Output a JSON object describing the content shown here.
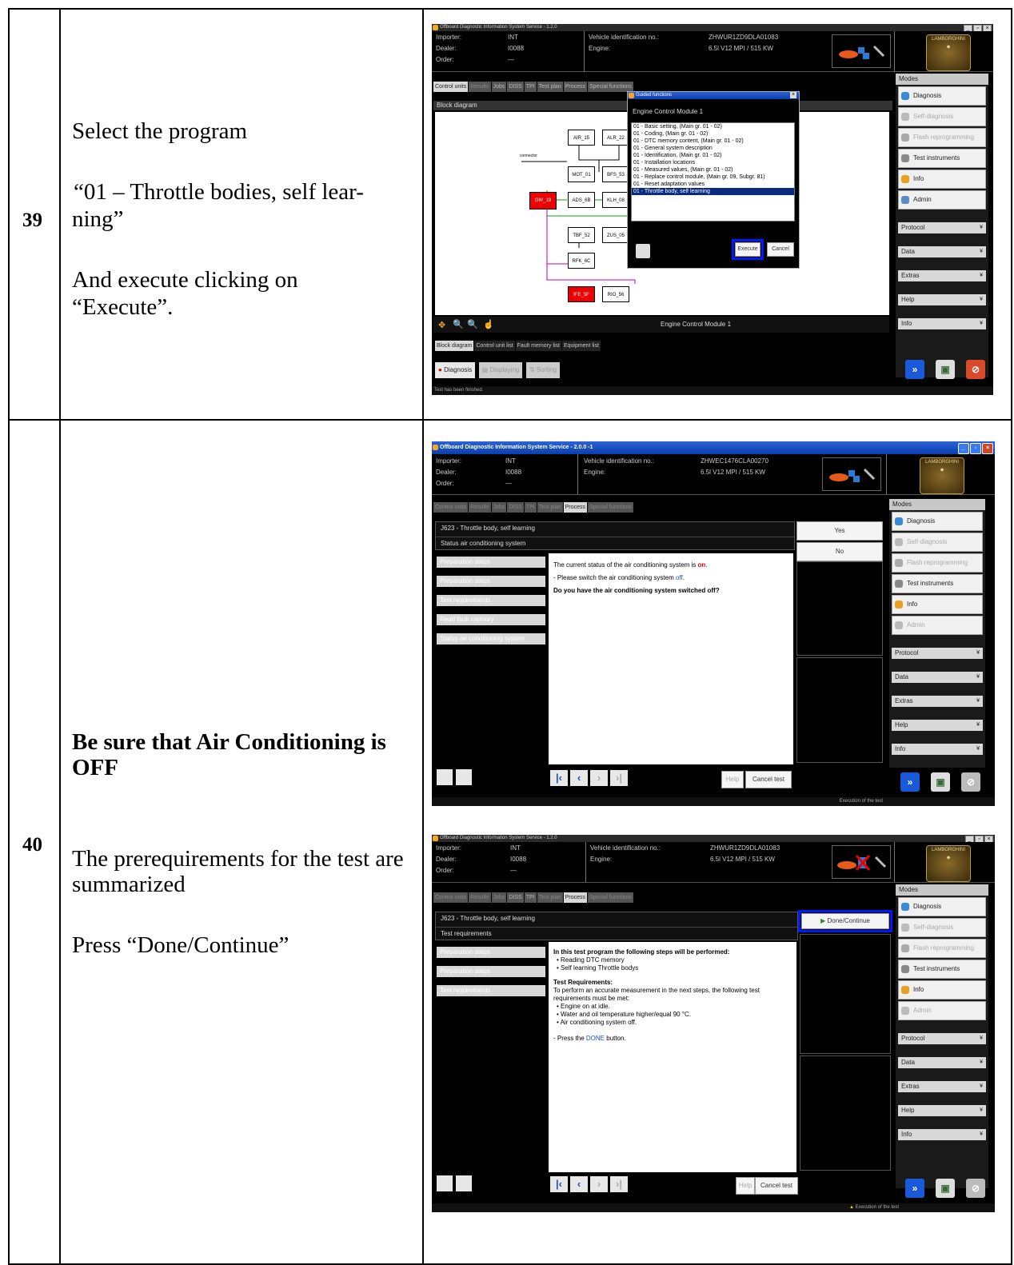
{
  "rows": [
    {
      "number": "39",
      "text": {
        "line1": "Select the program",
        "line2": "“01 – Throttle bodies, self lear-",
        "line3": "ning”",
        "line4": "And execute clicking on",
        "line5": "“Execute”."
      },
      "screenshot": {
        "window_title": "Offboard Diagnostic Information System Service - 1.2.0",
        "header": {
          "importer_label": "Importer:",
          "importer_value": "INT",
          "dealer_label": "Dealer:",
          "dealer_value": "I0088",
          "order_label": "Order:",
          "order_value": "—",
          "vin_label": "Vehicle identification no.:",
          "vin_value": "ZHWUR1ZD9DLA01083",
          "engine_label": "Engine:",
          "engine_value": "6.5l V12 MPI / 515 KW"
        },
        "tabs": [
          "Control units",
          "Results",
          "Jobs",
          "DISS",
          "TPI",
          "Test plan",
          "Process",
          "Special functions"
        ],
        "panel_title": "Block diagram",
        "connector_label": "connector",
        "blocks": [
          "AIR_15",
          "ALR_22",
          "MOT_01",
          "BFS_53",
          "GW_19",
          "ADS_6B",
          "KLH_08",
          "TBF_52",
          "ZUS_05",
          "RFK_6C",
          "IFE_5F",
          "RIO_56"
        ],
        "dialog": {
          "title": "Guided functions",
          "module": "Engine Control Module 1",
          "items": [
            "01 - Basic setting, (Main gr. 01 - 02)",
            "01 - Coding, (Main gr. 01 - 02)",
            "01 - DTC memory content, (Main gr. 01 - 02)",
            "01 - General system description",
            "01 - Identification, (Main gr. 01 - 02)",
            "01 - Installation locations",
            "01 - Measured values, (Main gr. 01 - 02)",
            "01 - Replace control module, (Main gr. 09, Subgr. 81)",
            "01 - Reset adaptation values",
            "01 - Throttle body, self learning"
          ],
          "execute": "Execute",
          "cancel": "Cancel"
        },
        "footer_module": "Engine Control Module 1",
        "bottom_tabs": [
          "Block diagram",
          "Control unit list",
          "Fault memory list",
          "Equipment list"
        ],
        "bottom_buttons": [
          "Diagnosis",
          "Displaying",
          "Sorting"
        ],
        "status": "Test has been finished."
      }
    },
    {
      "number": "40",
      "text": {
        "bold": "Be sure that Air Conditioning is OFF",
        "p1": "The prerequirements for the test are summarized",
        "p2": "Press “Done/Continue”"
      },
      "screenshot_a": {
        "window_title": "Offboard Diagnostic Information System Service - 2.0.0 -1",
        "header": {
          "importer_label": "Importer:",
          "importer_value": "INT",
          "dealer_label": "Dealer:",
          "dealer_value": "I0088",
          "order_label": "Order:",
          "order_value": "—",
          "vin_label": "Vehicle identification no.:",
          "vin_value": "ZHWEC1476CLA00270",
          "engine_label": "Engine:",
          "engine_value": "6.5l V12 MPI / 515 KW"
        },
        "process_title": "J623 - Throttle body, self learning",
        "process_subtitle": "Status air conditioning system",
        "yes": "Yes",
        "no": "No",
        "steps": [
          "Preparation steps",
          "Preparation steps",
          "Test requirements",
          "Read fault memory",
          "Status air conditioning system"
        ],
        "content_line1_pre": "The current status of the air conditioning system is ",
        "content_line1_val": "on",
        "content_line2_pre": "- Please switch the air conditioning system ",
        "content_line2_val": "off",
        "content_line3": "Do you have the air conditioning system switched off?",
        "help": "Help",
        "cancel_test": "Cancel test",
        "status": "Execution of the test"
      },
      "screenshot_b": {
        "window_title": "Offboard Diagnostic Information System Service - 1.2.0",
        "header": {
          "importer_label": "Importer:",
          "importer_value": "INT",
          "dealer_label": "Dealer:",
          "dealer_value": "I0088",
          "order_label": "Order:",
          "order_value": "—",
          "vin_label": "Vehicle identification no.:",
          "vin_value": "ZHWUR1ZD9DLA01083",
          "engine_label": "Engine:",
          "engine_value": "6.5l V12 MPI / 515 KW"
        },
        "process_title": "J623 - Throttle body, self learning",
        "process_subtitle": "Test requirements",
        "done_continue": "Done/Continue",
        "steps": [
          "Preparation steps",
          "Preparation steps",
          "Test requirements"
        ],
        "intro": "In this test program the following steps will be performed:",
        "bullets1": [
          "Reading DTC memory",
          "Self learning Throttle bodys"
        ],
        "req_title": "Test Requirements:",
        "req_text": "To perform an accurate measurement in the next steps, the following test requirements must be met:",
        "bullets2": [
          "Engine on at idle.",
          "Water and oil temperature higher/equal 90 °C.",
          "Air conditioning system off."
        ],
        "press_pre": "- Press the ",
        "press_done": "DONE",
        "press_post": " button.",
        "help": "Help",
        "cancel_test": "Cancel test",
        "status": "Execution of the test"
      }
    }
  ],
  "sidebar": {
    "modes": "Modes",
    "items": [
      "Diagnosis",
      "Self-diagnosis",
      "Flash reprogramming",
      "Test instruments",
      "Info",
      "Admin"
    ],
    "sections": [
      "Protocol",
      "Data",
      "Extras",
      "Help",
      "Info"
    ]
  },
  "logo_text": "LAMBORGHINI",
  "colors": {
    "highlight_blue": "#0018ff",
    "status_red": "#e00000",
    "link_blue": "#1f4fd0"
  }
}
